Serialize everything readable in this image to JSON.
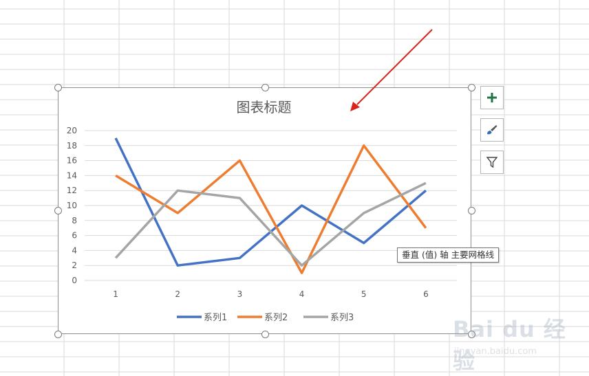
{
  "chart_data": {
    "type": "line",
    "title": "图表标题",
    "categories": [
      "1",
      "2",
      "3",
      "4",
      "5",
      "6"
    ],
    "series": [
      {
        "name": "系列1",
        "color": "#4472C4",
        "values": [
          19,
          2,
          3,
          10,
          5,
          12
        ]
      },
      {
        "name": "系列2",
        "color": "#ED7D31",
        "values": [
          14,
          9,
          16,
          1,
          18,
          7
        ]
      },
      {
        "name": "系列3",
        "color": "#A5A5A5",
        "values": [
          3,
          12,
          11,
          2,
          9,
          13
        ]
      }
    ],
    "y_ticks": [
      "0",
      "2",
      "4",
      "6",
      "8",
      "10",
      "12",
      "14",
      "16",
      "18",
      "20"
    ],
    "ylim": [
      0,
      20
    ],
    "grid": true,
    "legend_position": "bottom"
  },
  "tooltip": "垂直 (值) 轴 主要网格线",
  "side_buttons": [
    {
      "icon": "plus-icon",
      "color": "#217346"
    },
    {
      "icon": "brush-icon"
    },
    {
      "icon": "filter-icon"
    }
  ],
  "arrow_color": "#D9231C",
  "watermark": {
    "brand": "Bai du 经验",
    "url": "jingyan.baidu.com"
  }
}
